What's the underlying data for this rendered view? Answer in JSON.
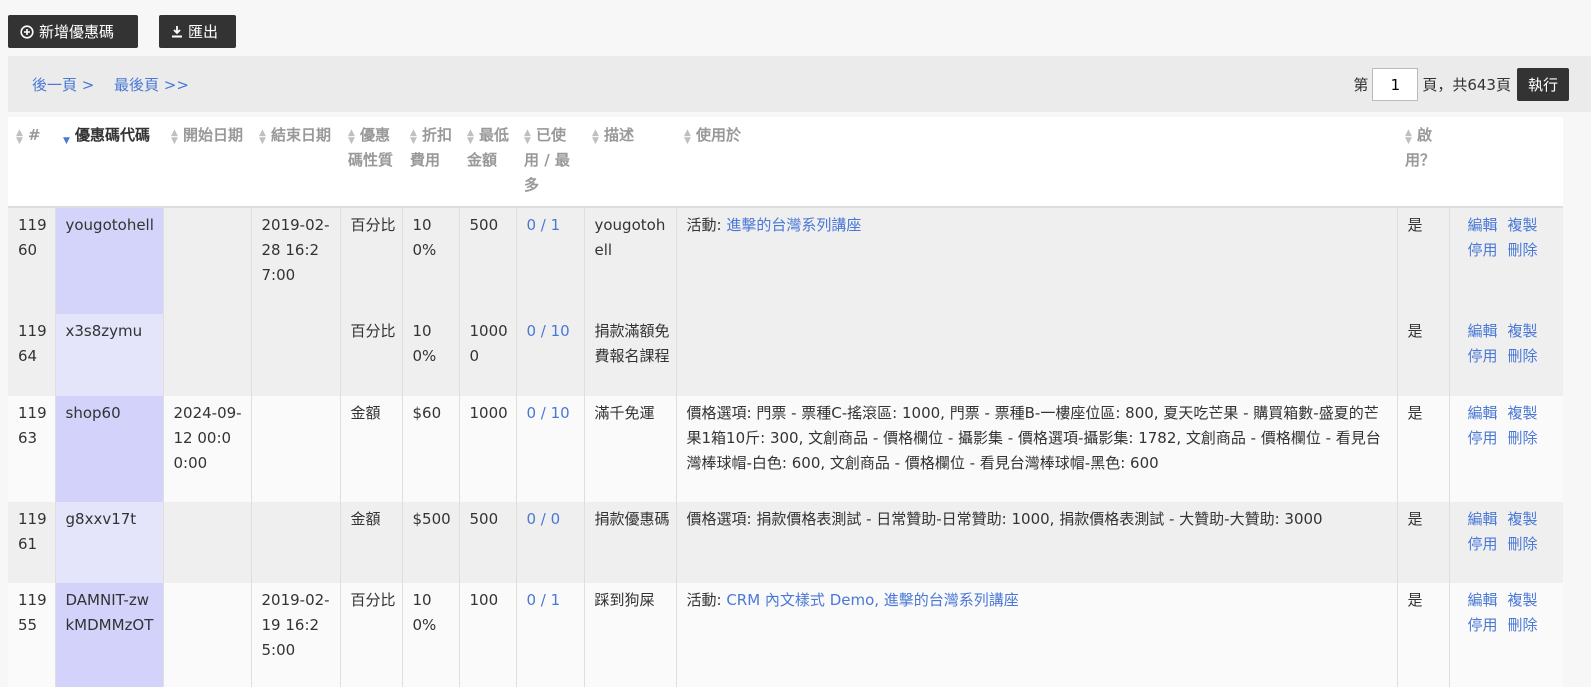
{
  "toolbar": {
    "add_label": "新增優惠碼",
    "export_label": "匯出"
  },
  "pager": {
    "next_label": "後一頁 >",
    "last_label": "最後頁 >>",
    "page_prefix": "第",
    "page_value": "1",
    "page_suffix": "頁，共643頁",
    "run_label": "執行"
  },
  "table": {
    "headers": {
      "num": "#",
      "code": "優惠碼代碼",
      "start": "開始日期",
      "end": "結束日期",
      "type": "優惠碼性質",
      "discount": "折扣費用",
      "min": "最低金額",
      "used": "已使用 / 最多",
      "desc": "描述",
      "usedin": "使用於",
      "enabled": "啟用？"
    },
    "rows": [
      {
        "id": "11960",
        "code": "yougotohell",
        "start": "",
        "end": "2019-02-28 16:27:00",
        "type": "百分比",
        "discount": "100%",
        "min": "500",
        "used": "0 / 1",
        "desc": "yougotohell",
        "usedin_prefix": "活動: ",
        "usedin_links": "進擊的台灣系列講座",
        "usedin_text": "",
        "enabled": "是"
      },
      {
        "id": "11964",
        "code": "x3s8zymu",
        "start": "",
        "end": "",
        "type": "百分比",
        "discount": "100%",
        "min": "10000",
        "used": "0 / 10",
        "desc": "捐款滿額免費報名課程",
        "usedin_prefix": "",
        "usedin_links": "",
        "usedin_text": "",
        "enabled": "是"
      },
      {
        "id": "11963",
        "code": "shop60",
        "start": "2024-09-12 00:00:00",
        "end": "",
        "type": "金額",
        "discount": "$60",
        "min": "1000",
        "used": "0 / 10",
        "desc": "滿千免運",
        "usedin_prefix": "",
        "usedin_links": "",
        "usedin_text": "價格選項: 門票 - 票種C-搖滾區: 1000, 門票 - 票種B-一樓座位區: 800, 夏天吃芒果 - 購買箱數-盛夏的芒果1箱10斤: 300, 文創商品 - 價格欄位 - 攝影集 - 價格選項-攝影集: 1782, 文創商品 - 價格欄位 - 看見台灣棒球帽-白色: 600, 文創商品 - 價格欄位 - 看見台灣棒球帽-黑色: 600",
        "enabled": "是"
      },
      {
        "id": "11961",
        "code": "g8xxv17t",
        "start": "",
        "end": "",
        "type": "金額",
        "discount": "$500",
        "min": "500",
        "used": "0 / 0",
        "desc": "捐款優惠碼",
        "usedin_prefix": "",
        "usedin_links": "",
        "usedin_text": "價格選項: 捐款價格表測試 - 日常贊助-日常贊助: 1000, 捐款價格表測試 - 大贊助-大贊助: 3000",
        "enabled": "是"
      },
      {
        "id": "11955",
        "code": "DAMNIT-zwkMDMMzOT",
        "start": "",
        "end": "2019-02-19 16:25:00",
        "type": "百分比",
        "discount": "100%",
        "min": "100",
        "used": "0 / 1",
        "desc": "踩到狗屎",
        "usedin_prefix": "活動: ",
        "usedin_links": "CRM 內文樣式 Demo, 進擊的台灣系列講座",
        "usedin_text": "",
        "enabled": "是"
      }
    ],
    "actions": {
      "edit": "編輯",
      "copy": "複製",
      "disable": "停用",
      "delete": "刪除"
    }
  }
}
